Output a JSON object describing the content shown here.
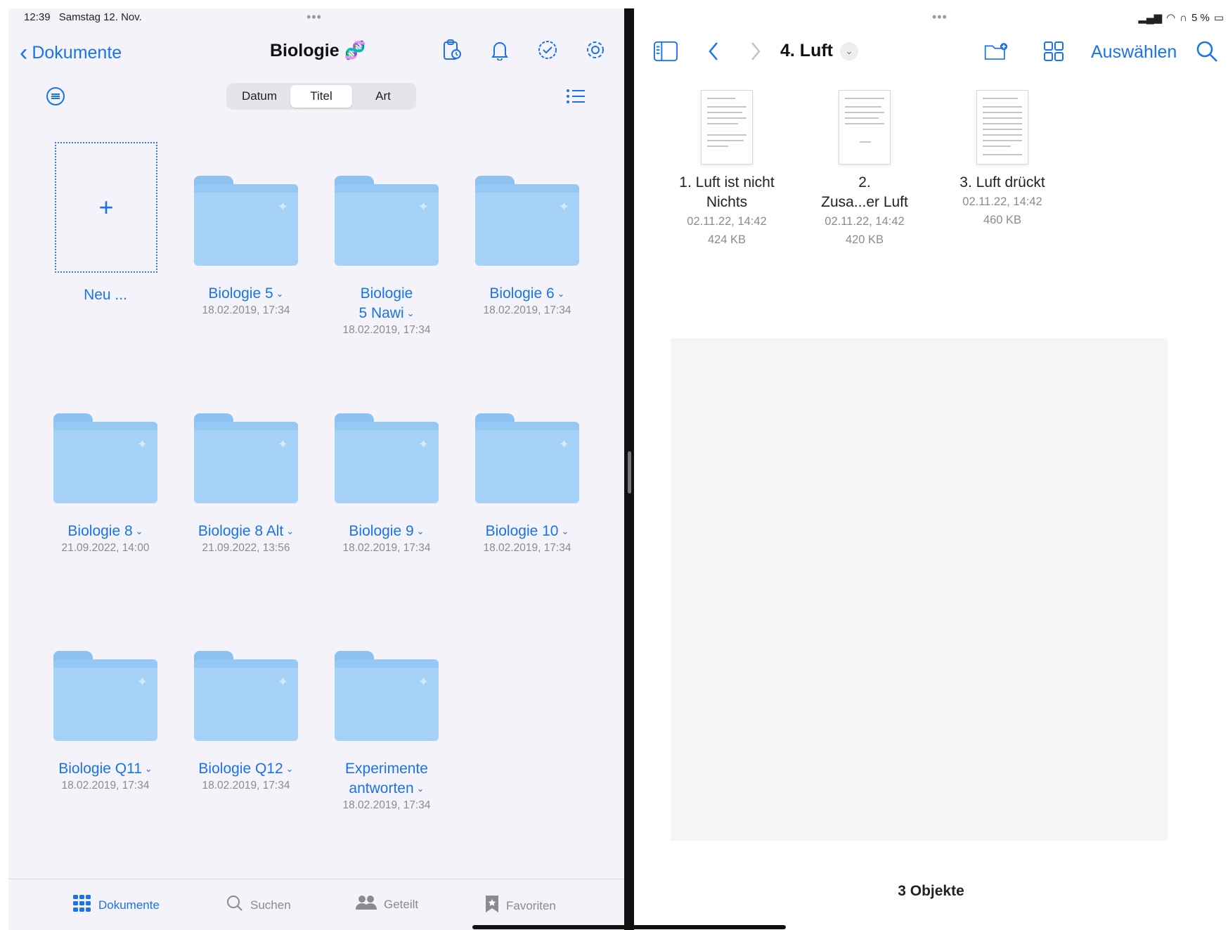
{
  "left": {
    "status": {
      "time": "12:39",
      "date": "Samstag 12. Nov."
    },
    "multitask_dots": "•••",
    "back_label": "Dokumente",
    "title": "Biologie 🧬",
    "sort": {
      "options": [
        "Datum",
        "Titel",
        "Art"
      ],
      "selected": "Titel"
    },
    "new_label": "Neu ...",
    "new_symbol": "+",
    "folders": [
      {
        "name": "Biologie 5",
        "date": "18.02.2019, 17:34"
      },
      {
        "name": "Biologie 5 Nawi",
        "name_line1": "Biologie",
        "name_line2": "5 Nawi",
        "date": "18.02.2019, 17:34"
      },
      {
        "name": "Biologie 6",
        "date": "18.02.2019, 17:34"
      },
      {
        "name": "Biologie 8",
        "date": "21.09.2022, 14:00"
      },
      {
        "name": "Biologie 8 Alt",
        "date": "21.09.2022, 13:56"
      },
      {
        "name": "Biologie 9",
        "date": "18.02.2019, 17:34"
      },
      {
        "name": "Biologie 10",
        "date": "18.02.2019, 17:34"
      },
      {
        "name": "Biologie Q11",
        "date": "18.02.2019, 17:34"
      },
      {
        "name": "Biologie Q12",
        "date": "18.02.2019, 17:34"
      },
      {
        "name": "Experimente antworten",
        "name_line1": "Experimente",
        "name_line2": "antworten",
        "date": "18.02.2019, 17:34"
      }
    ],
    "dropdown_glyph": "⌄",
    "tabbar": [
      {
        "label": "Dokumente",
        "icon": "grid-icon",
        "active": true
      },
      {
        "label": "Suchen",
        "icon": "search-icon",
        "active": false
      },
      {
        "label": "Geteilt",
        "icon": "people-icon",
        "active": false
      },
      {
        "label": "Favoriten",
        "icon": "bookmark-icon",
        "active": false
      }
    ]
  },
  "right": {
    "status": {
      "battery": "5 %"
    },
    "multitask_dots": "•••",
    "title": "4. Luft",
    "select_label": "Auswählen",
    "documents": [
      {
        "name_line1": "1. Luft ist nicht",
        "name_line2": "Nichts",
        "date": "02.11.22, 14:42",
        "size": "424 KB"
      },
      {
        "name_line1": "2.",
        "name_line2": "Zusa...er Luft",
        "date": "02.11.22, 14:42",
        "size": "420 KB"
      },
      {
        "name_line1": "3. Luft drückt",
        "name_line2": "",
        "date": "02.11.22, 14:42",
        "size": "460 KB"
      }
    ],
    "item_count": "3 Objekte"
  },
  "colors": {
    "accent": "#1a73e8",
    "folder": "#a6d1f7",
    "background_left": "#f3f3f9"
  }
}
